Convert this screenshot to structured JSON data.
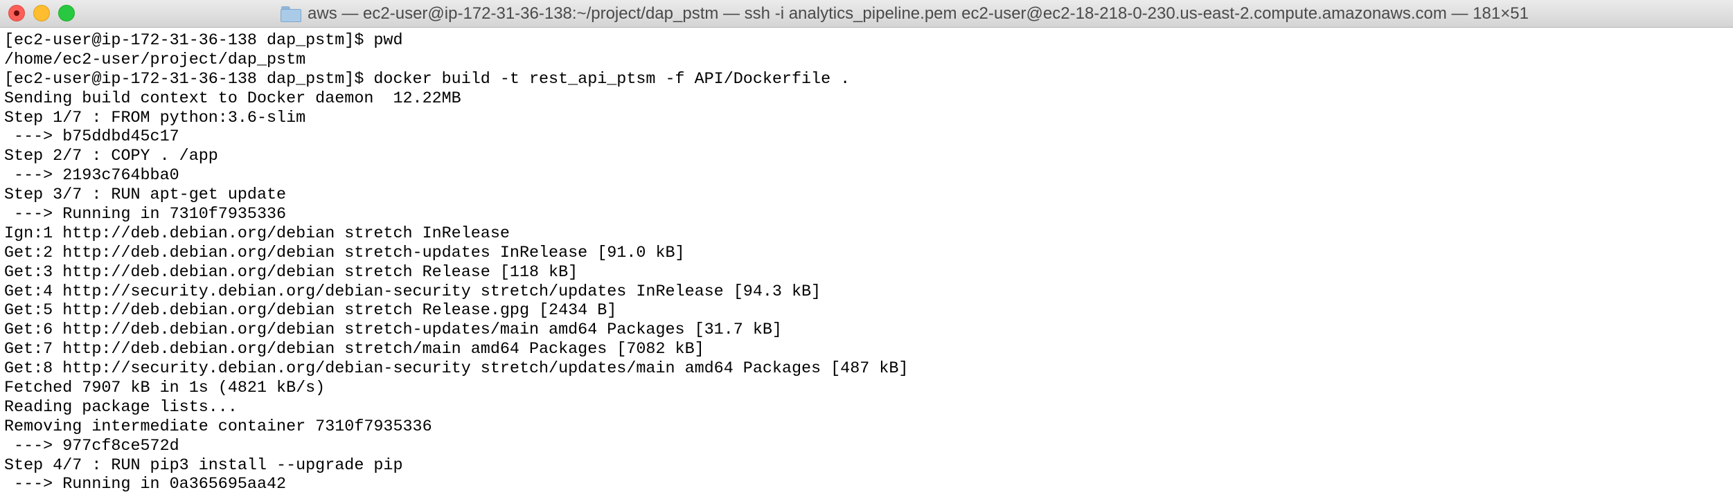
{
  "window": {
    "title": "aws — ec2-user@ip-172-31-36-138:~/project/dap_pstm — ssh -i analytics_pipeline.pem ec2-user@ec2-18-218-0-230.us-east-2.compute.amazonaws.com — 181×51",
    "title_icon": "folder-icon",
    "buttons": {
      "close": "close-button",
      "minimize": "minimize-button",
      "zoom": "zoom-button"
    },
    "colors": {
      "close": "#fc5f57",
      "minimize": "#fdbd2e",
      "zoom": "#28c940",
      "background": "#ffffff",
      "text": "#000000"
    }
  },
  "terminal": {
    "lines": [
      "[ec2-user@ip-172-31-36-138 dap_pstm]$ pwd",
      "/home/ec2-user/project/dap_pstm",
      "[ec2-user@ip-172-31-36-138 dap_pstm]$ docker build -t rest_api_ptsm -f API/Dockerfile .",
      "Sending build context to Docker daemon  12.22MB",
      "Step 1/7 : FROM python:3.6-slim",
      " ---> b75ddbd45c17",
      "Step 2/7 : COPY . /app",
      " ---> 2193c764bba0",
      "Step 3/7 : RUN apt-get update",
      " ---> Running in 7310f7935336",
      "Ign:1 http://deb.debian.org/debian stretch InRelease",
      "Get:2 http://deb.debian.org/debian stretch-updates InRelease [91.0 kB]",
      "Get:3 http://deb.debian.org/debian stretch Release [118 kB]",
      "Get:4 http://security.debian.org/debian-security stretch/updates InRelease [94.3 kB]",
      "Get:5 http://deb.debian.org/debian stretch Release.gpg [2434 B]",
      "Get:6 http://deb.debian.org/debian stretch-updates/main amd64 Packages [31.7 kB]",
      "Get:7 http://deb.debian.org/debian stretch/main amd64 Packages [7082 kB]",
      "Get:8 http://security.debian.org/debian-security stretch/updates/main amd64 Packages [487 kB]",
      "Fetched 7907 kB in 1s (4821 kB/s)",
      "Reading package lists...",
      "Removing intermediate container 7310f7935336",
      " ---> 977cf8ce572d",
      "Step 4/7 : RUN pip3 install --upgrade pip",
      " ---> Running in 0a365695aa42"
    ]
  }
}
